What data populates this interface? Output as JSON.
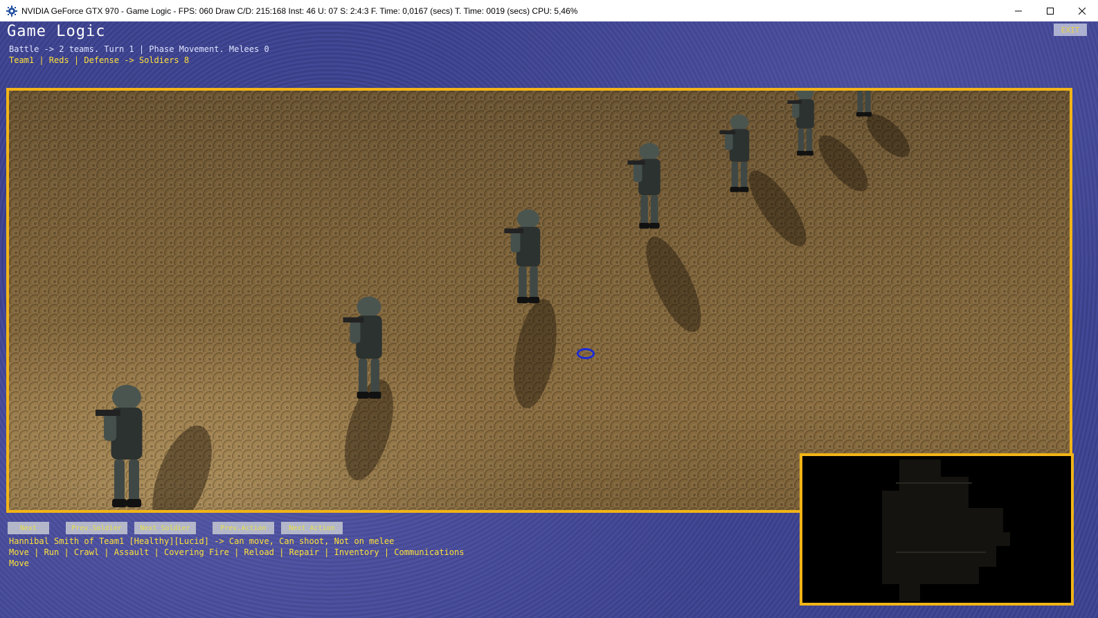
{
  "window": {
    "title": "NVIDIA GeForce GTX 970 - Game Logic - FPS: 060 Draw C/D: 215:168 Inst: 46 U: 07 S: 2:4:3 F. Time: 0,0167 (secs) T. Time: 0019 (secs) CPU: 5,46%",
    "icon": "gear-icon"
  },
  "hud": {
    "title": "Game Logic",
    "battle_line": "Battle -> 2 teams. Turn 1 | Phase Movement. Melees 0",
    "team_line": "Team1 | Reds | Defense -> Soldiers 8",
    "exit_label": "EXIT"
  },
  "buttons": {
    "next": "Next",
    "prev_soldier": "Prev.Soldier",
    "next_soldier": "Next Soldier",
    "prev_action": "Prev.Action",
    "next_action": "Next Action"
  },
  "status": {
    "soldier_line": "Hannibal Smith of Team1 [Healthy][Lucid] -> Can move, Can shoot, Not on melee",
    "actions_line": "Move | Run | Crawl | Assault | Covering Fire | Reload | Repair | Inventory | Communications",
    "selected_action": "Move"
  },
  "colors": {
    "accent_frame": "#f2b417",
    "hud_yellow": "#ffe23a",
    "backdrop_blue": "#3b408a"
  }
}
